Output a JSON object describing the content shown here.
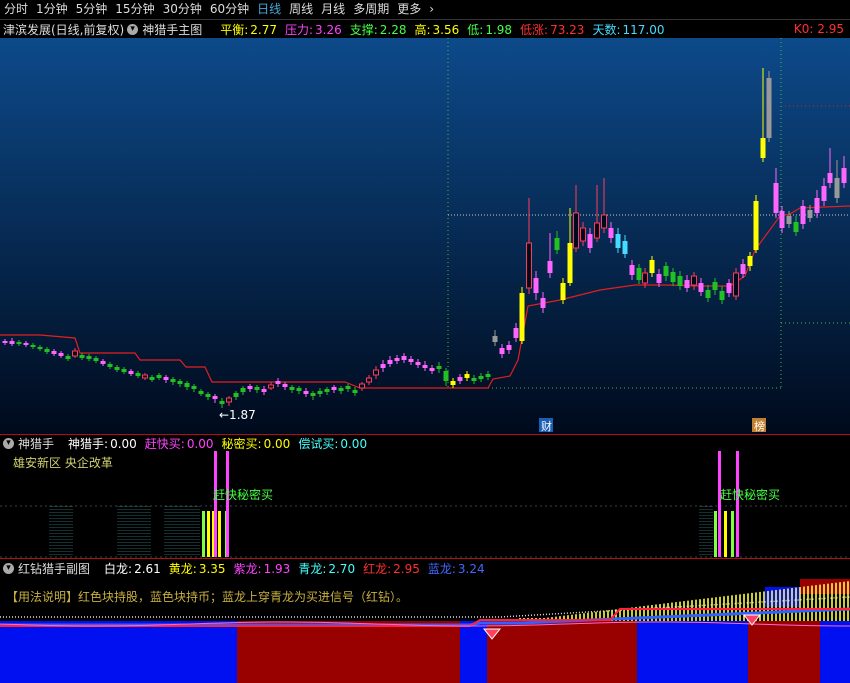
{
  "toolbar": {
    "periods": [
      "分时",
      "1分钟",
      "5分钟",
      "15分钟",
      "30分钟",
      "60分钟",
      "日线",
      "周线",
      "月线",
      "多周期",
      "更多"
    ],
    "active": "日线",
    "more_icon": "chevron-right-icon"
  },
  "main_header": {
    "stock": "津滨发展(日线,前复权)",
    "indicator": "神猎手主图",
    "items": [
      {
        "label": "平衡:",
        "value": "2.77",
        "color": "#ffff00"
      },
      {
        "label": "压力:",
        "value": "3.26",
        "color": "#ff44ff"
      },
      {
        "label": "支撑:",
        "value": "2.28",
        "color": "#44ff44"
      },
      {
        "label": "高:",
        "value": "3.56",
        "color": "#ffff00"
      },
      {
        "label": "低:",
        "value": "1.98",
        "color": "#44ff44"
      },
      {
        "label": "低涨:",
        "value": "73.23",
        "color": "#ff3030"
      },
      {
        "label": "天数:",
        "value": "117.00",
        "color": "#44ddff"
      }
    ],
    "k0": "K0: 2.95",
    "k0_color": "#ff3030"
  },
  "main_chart": {
    "low_label": "←1.87",
    "markers": [
      {
        "text": "财"
      },
      {
        "text": "榜"
      }
    ]
  },
  "panel2": {
    "name": "神猎手",
    "items": [
      {
        "label": "神猎手:",
        "value": "0.00",
        "color": "#ffffff"
      },
      {
        "label": "赶快买:",
        "value": "0.00",
        "color": "#ff44ff"
      },
      {
        "label": "秘密买:",
        "value": "0.00",
        "color": "#ffff00"
      },
      {
        "label": "偿试买:",
        "value": "0.00",
        "color": "#44ffff"
      }
    ],
    "tags": "雄安新区 央企改革",
    "signal_text": "赶快秘密买"
  },
  "panel3": {
    "name": "红钻猎手副图",
    "items": [
      {
        "label": "白龙:",
        "value": "2.61",
        "color": "#ffffff"
      },
      {
        "label": "黄龙:",
        "value": "3.35",
        "color": "#ffff00"
      },
      {
        "label": "紫龙:",
        "value": "1.93",
        "color": "#ff44ff"
      },
      {
        "label": "青龙:",
        "value": "2.70",
        "color": "#44ffff"
      },
      {
        "label": "红龙:",
        "value": "2.95",
        "color": "#ff3030"
      },
      {
        "label": "蓝龙:",
        "value": "3.24",
        "color": "#4466ff"
      }
    ],
    "note": "【用法说明】红色块持股，蓝色块持币；蓝龙上穿青龙为买进信号（红钻）。"
  },
  "colors": {
    "up": "#ff3b5c",
    "down": "#22c022",
    "pink": "#ff66ff",
    "yellow": "#ffff00",
    "grey": "#999999",
    "support": "#e02020"
  }
}
